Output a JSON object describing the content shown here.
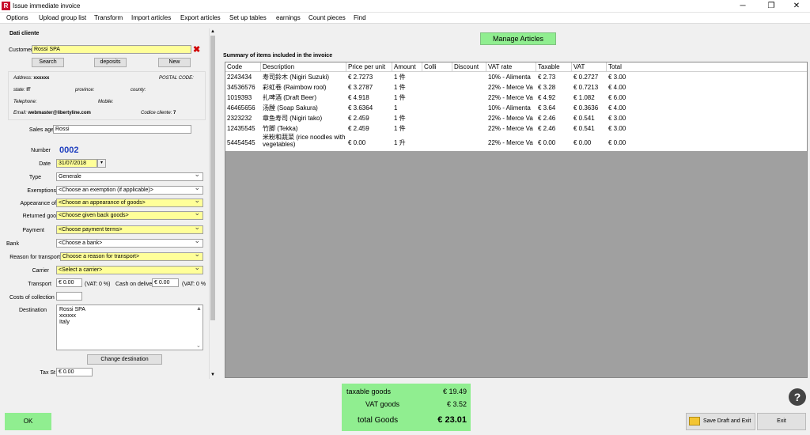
{
  "window": {
    "title": "Issue immediate invoice",
    "app_icon": "app-icon",
    "controls": [
      "─",
      "❐",
      "✕"
    ]
  },
  "menu": [
    "Options",
    "Upload group list",
    "Transform",
    "Import articles",
    "Export articles",
    "Set up tables",
    "earnings",
    "Count pieces",
    "Find"
  ],
  "customer": {
    "section_title": "Dati cliente",
    "label": "Customer",
    "value": "Rossi SPA",
    "search_label": "Search",
    "deposits_label": "deposits",
    "new_label": "New",
    "address_label": "Address:",
    "address_value": "xxxxxx",
    "postal_label": "POSTAL CODE:",
    "state_label": "state:",
    "state_value": "IT",
    "province_label": "province:",
    "county_label": "county:",
    "telephone_label": "Telephone:",
    "mobile_label": "Mobile:",
    "email_label": "Email:",
    "email_value": "webmaster@libertyline.com",
    "code_label": "Codice cliente:",
    "code_value": "7"
  },
  "form": {
    "sales_agent_label": "Sales age",
    "sales_agent_value": "Rossi",
    "number_label": "Number",
    "number_value": "0002",
    "date_label": "Date",
    "date_value": "31/07/2018",
    "type_label": "Type",
    "type_value": "Generale",
    "exemptions_label": "Exemptions",
    "exemptions_value": "<Choose an exemption (if applicable)>",
    "appearance_label": "Appearance of",
    "appearance_value": "<Choose an appearance of goods>",
    "returned_label": "Returned goo",
    "returned_value": "<Choose given back goods>",
    "payment_label": "Payment",
    "payment_value": "<Choose payment terms>",
    "bank_label": "Bank",
    "bank_value": "<Choose a bank>",
    "reason_label": "Reason for transport",
    "reason_value": "Choose a reason for transport>",
    "carrier_label": "Carrier",
    "carrier_value": "<Select a carrier>",
    "transport_label": "Transport",
    "transport_value": "€ 0.00",
    "transport_vat": "(VAT: 0 %)",
    "cod_label": "Cash on deliver",
    "cod_value": "€ 0.00",
    "cod_vat": "(VAT: 0 %",
    "collection_label": "Costs of collection",
    "destination_label": "Destination",
    "destination_lines": [
      "Rossi SPA",
      "xxxxxx",
      "Italy"
    ],
    "change_dest_label": "Change destination",
    "tax_label": "Tax St",
    "tax_value": "€ 0.00"
  },
  "manage_articles_label": "Manage Articles",
  "summary_title": "Summary of items included in the invoice",
  "table": {
    "headers": [
      "Code",
      "Description",
      "Price per unit",
      "Amount",
      "Colli",
      "Discount",
      "VAT rate",
      "Taxable",
      "VAT",
      "Total"
    ],
    "rows": [
      [
        "2243434",
        "寿司鈴木 (Nigiri Suzuki)",
        "€ 2.7273",
        "1 件",
        "",
        "",
        "10% - Alimenta",
        "€ 2.73",
        "€ 0.2727",
        "€ 3.00"
      ],
      [
        "34536576",
        "彩虹卷 (Raimbow rool)",
        "€ 3.2787",
        "1 件",
        "",
        "",
        "22% - Merce Va",
        "€ 3.28",
        "€ 0.7213",
        "€ 4.00"
      ],
      [
        "1019393",
        "扎啤酒 (Draft Beer)",
        "€ 4.918",
        "1 件",
        "",
        "",
        "22% - Merce Va",
        "€ 4.92",
        "€ 1.082",
        "€ 6.00"
      ],
      [
        "46465656",
        "汤膛 (Soap Sakura)",
        "€ 3.6364",
        "1",
        "",
        "",
        "10% - Alimenta",
        "€ 3.64",
        "€ 0.3636",
        "€ 4.00"
      ],
      [
        "2323232",
        "章鱼寿司 (Nigiri tako)",
        "€ 2.459",
        "1 件",
        "",
        "",
        "22% - Merce Va",
        "€ 2.46",
        "€ 0.541",
        "€ 3.00"
      ],
      [
        "12435545",
        "竹脚 (Tekka)",
        "€ 2.459",
        "1 件",
        "",
        "",
        "22% - Merce Va",
        "€ 2.46",
        "€ 0.541",
        "€ 3.00"
      ],
      [
        "54454545",
        "米粉和蔬菜 (rice noodles with vegetables)",
        "€ 0.00",
        "1 升",
        "",
        "",
        "22% - Merce Va",
        "€ 0.00",
        "€ 0.00",
        "€ 0.00"
      ]
    ]
  },
  "totals": {
    "taxable_label": "taxable goods",
    "taxable_value": "€ 19.49",
    "vat_label": "VAT goods",
    "vat_value": "€ 3.52",
    "total_label": "total Goods",
    "total_value": "€ 23.01"
  },
  "buttons": {
    "ok": "OK",
    "save_draft": "Save Draft and Exit",
    "exit": "Exit",
    "help": "?"
  },
  "colors": {
    "accent_green": "#90ee90",
    "highlight_yellow": "#ffff99",
    "number_blue": "#1f3fbf",
    "delete_red": "#d00000"
  }
}
